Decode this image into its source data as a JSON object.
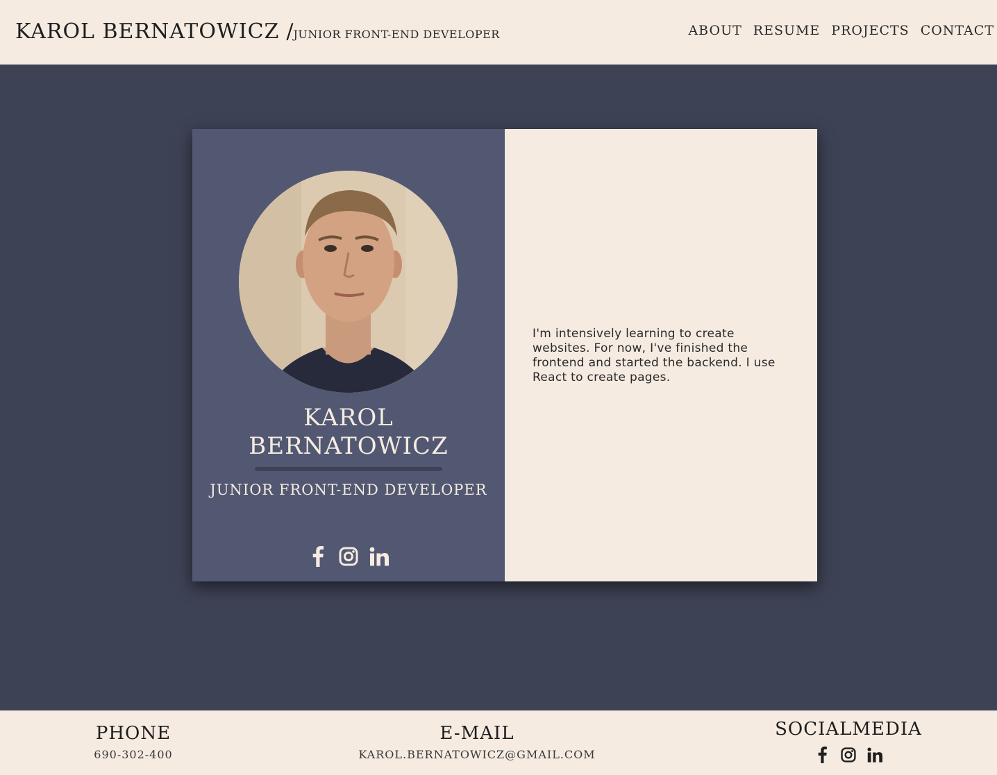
{
  "header": {
    "name": "KAROL BERNATOWICZ",
    "separator": "/",
    "subtitle": "JUNIOR FRONT-END DEVELOPER",
    "nav": [
      "ABOUT",
      "RESUME",
      "PROJECTS",
      "CONTACT"
    ]
  },
  "card": {
    "name_line1": "KAROL",
    "name_line2": "BERNATOWICZ",
    "role": "JUNIOR FRONT-END DEVELOPER",
    "bio": "I'm intensively learning to create websites. For now, I've finished the frontend and started the backend. I use React to create pages.",
    "social_icons": [
      "facebook-icon",
      "instagram-icon",
      "linkedin-icon"
    ]
  },
  "footer": {
    "phone_title": "PHONE",
    "phone_value": "690-302-400",
    "email_title": "E-MAIL",
    "email_value": "KAROL.BERNATOWICZ@GMAIL.COM",
    "social_title": "SOCIALMEDIA",
    "social_icons": [
      "facebook-icon",
      "instagram-icon",
      "linkedin-icon"
    ]
  },
  "colors": {
    "page_bg": "#3d4255",
    "panel_bg": "#f5ebe1",
    "card_left_bg": "#525872",
    "text_dark": "#1e1e1e",
    "text_light": "#f5ebe1"
  }
}
